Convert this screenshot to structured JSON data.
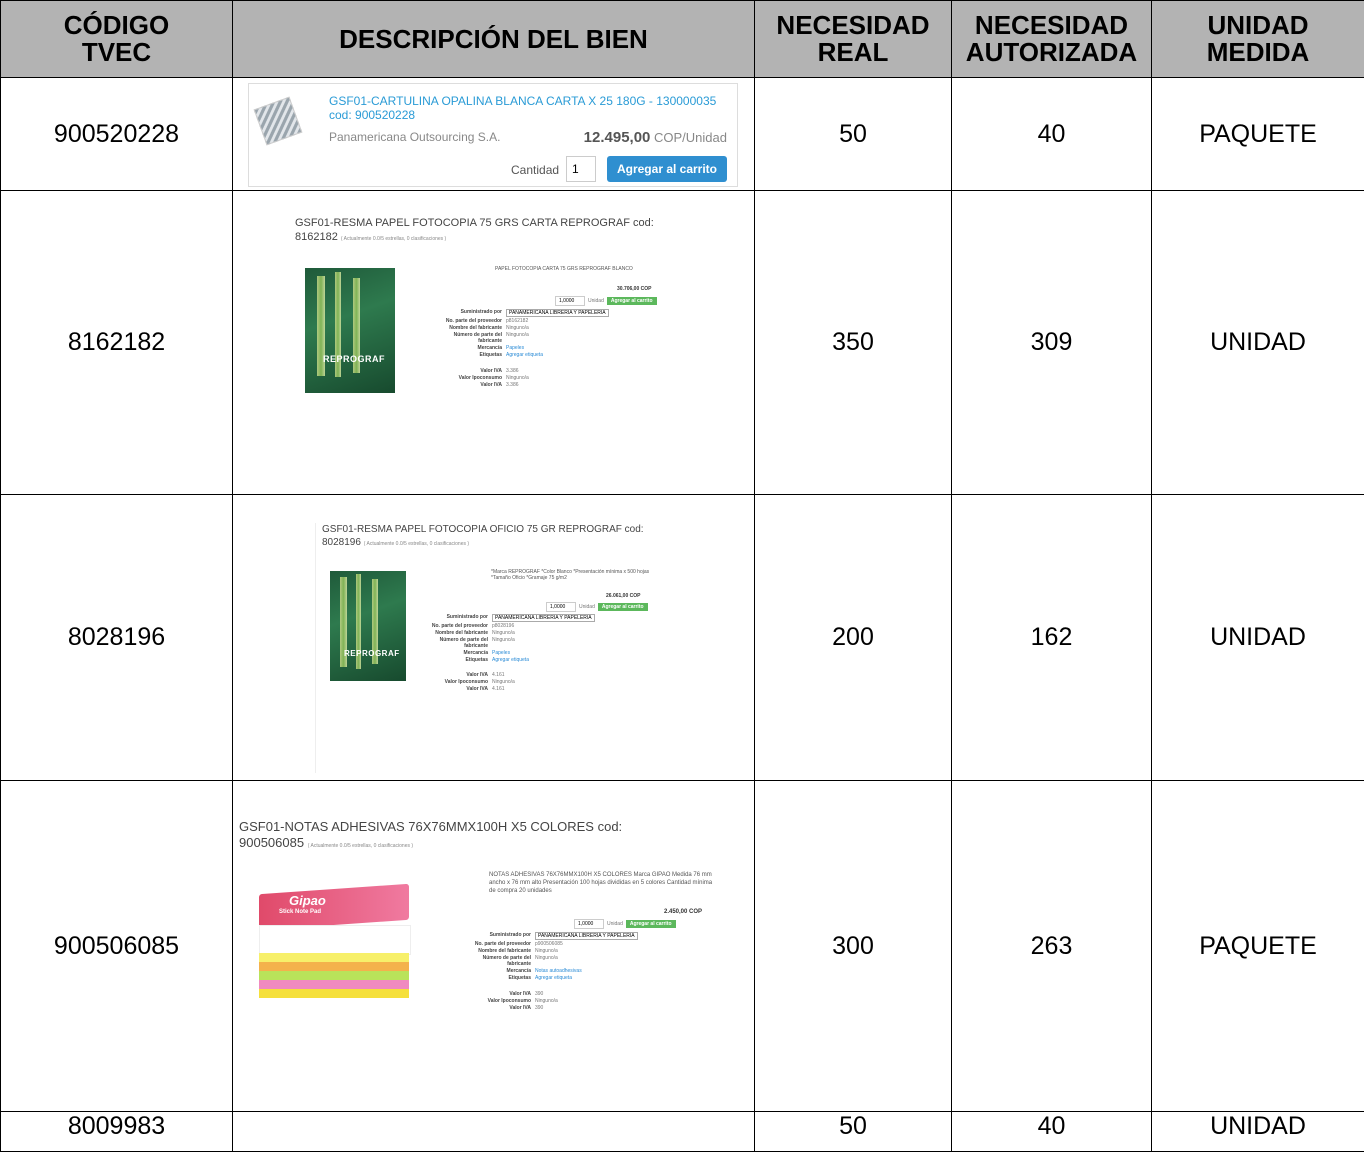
{
  "headers": {
    "codigo": "CÓDIGO TVEC",
    "descripcion": "DESCRIPCIÓN DEL BIEN",
    "necesidad_real": "NECESIDAD REAL",
    "necesidad_autorizada": "NECESIDAD AUTORIZADA",
    "unidad": "UNIDAD MEDIDA"
  },
  "rows": [
    {
      "codigo": "900520228",
      "real": "50",
      "autorizada": "40",
      "unidad": "PAQUETE",
      "product": {
        "title": "GSF01-CARTULINA OPALINA BLANCA CARTA X 25 180G - 130000035",
        "cod": "cod: 900520228",
        "vendor": "Panamericana Outsourcing S.A.",
        "price": "12.495,00",
        "price_unit": "COP/Unidad",
        "qty_label": "Cantidad",
        "qty": "1",
        "cart": "Agregar al carrito"
      }
    },
    {
      "codigo": "8162182",
      "real": "350",
      "autorizada": "309",
      "unidad": "UNIDAD",
      "product": {
        "title": "GSF01-RESMA PAPEL FOTOCOPIA 75 GRS CARTA REPROGRAF cod:",
        "cod": "8162182",
        "rating": "( Actualmente 0.0/5 estrellas, 0 clasificaciones )",
        "desc": "PAPEL FOTOCOPIA CARTA 75 GRS REPROGRAF BLANCO",
        "price": "30.706,00 COP",
        "qty": "1,0000",
        "unit": "Unidad",
        "cart": "Agregar al carrito",
        "brand": "REPROGRAF",
        "specs": [
          {
            "k": "Suministrado por",
            "v": "PANAMERICANA LIBRERIA Y PAPELERIA"
          },
          {
            "k": "No. parte del proveedor",
            "v": "p8162182"
          },
          {
            "k": "Nombre del fabricante",
            "v": "Ninguno/a"
          },
          {
            "k": "Número de parte del fabricante",
            "v": "Ninguno/a"
          },
          {
            "k": "Mercancía",
            "v": "Papeles"
          },
          {
            "k": "Etiquetas",
            "v": "Agregar etiqueta"
          },
          {
            "k": "Valor IVA",
            "v": "3.386"
          },
          {
            "k": "Valor Ipoconsumo",
            "v": "Ninguno/a"
          },
          {
            "k": "Valor IVA",
            "v": "3.386"
          }
        ]
      }
    },
    {
      "codigo": "8028196",
      "real": "200",
      "autorizada": "162",
      "unidad": "UNIDAD",
      "product": {
        "title": "GSF01-RESMA PAPEL FOTOCOPIA OFICIO 75 GR REPROGRAF cod:",
        "cod": "8028196",
        "rating": "( Actualmente 0.0/5 estrellas, 0 clasificaciones )",
        "desc": "*Marca REPROGRAF *Color Blanco *Presentación mínima x 500 hojas *Tamaño Oficio *Gramaje 75 g/m2",
        "price": "26.061,00 COP",
        "qty": "1,0000",
        "unit": "Unidad",
        "cart": "Agregar al carrito",
        "brand": "REPROGRAF",
        "specs": [
          {
            "k": "Suministrado por",
            "v": "PANAMERICANA LIBRERIA Y PAPELERIA"
          },
          {
            "k": "No. parte del proveedor",
            "v": "p8028196"
          },
          {
            "k": "Nombre del fabricante",
            "v": "Ninguno/a"
          },
          {
            "k": "Número de parte del fabricante",
            "v": "Ninguno/a"
          },
          {
            "k": "Mercancía",
            "v": "Papeles"
          },
          {
            "k": "Etiquetas",
            "v": "Agregar etiqueta"
          },
          {
            "k": "Valor IVA",
            "v": "4.161"
          },
          {
            "k": "Valor Ipoconsumo",
            "v": "Ninguno/a"
          },
          {
            "k": "Valor IVA",
            "v": "4.161"
          }
        ]
      }
    },
    {
      "codigo": "900506085",
      "real": "300",
      "autorizada": "263",
      "unidad": "PAQUETE",
      "product": {
        "title": "GSF01-NOTAS ADHESIVAS 76X76MMX100H X5 COLORES cod:",
        "cod": "900506085",
        "rating": "( Actualmente 0.0/5 estrellas, 0 clasificaciones )",
        "desc": "NOTAS ADHESIVAS 76X76MMX100H X5 COLORES Marca GIPAO Medida 76 mm ancho x 76 mm alto Presentación 100 hojas divididas en 5 colores Cantidad mínima de compra 20 unidades",
        "price": "2.450,00 COP",
        "qty": "1,0000",
        "unit": "Unidad",
        "cart": "Agregar al carrito",
        "brand": "Gipao",
        "pad_text": "Stick Note Pad",
        "specs": [
          {
            "k": "Suministrado por",
            "v": "PANAMERICANA LIBRERIA Y PAPELERIA"
          },
          {
            "k": "No. parte del proveedor",
            "v": "p900506085"
          },
          {
            "k": "Nombre del fabricante",
            "v": "Ninguno/a"
          },
          {
            "k": "Número de parte del fabricante",
            "v": "Ninguno/a"
          },
          {
            "k": "Mercancía",
            "v": "Notas autoadhesivas"
          },
          {
            "k": "Etiquetas",
            "v": "Agregar etiqueta"
          },
          {
            "k": "Valor IVA",
            "v": "390"
          },
          {
            "k": "Valor Ipoconsumo",
            "v": "Ninguno/a"
          },
          {
            "k": "Valor IVA",
            "v": "390"
          }
        ]
      }
    },
    {
      "codigo": "8009983",
      "real": "50",
      "autorizada": "40",
      "unidad": "UNIDAD"
    }
  ]
}
